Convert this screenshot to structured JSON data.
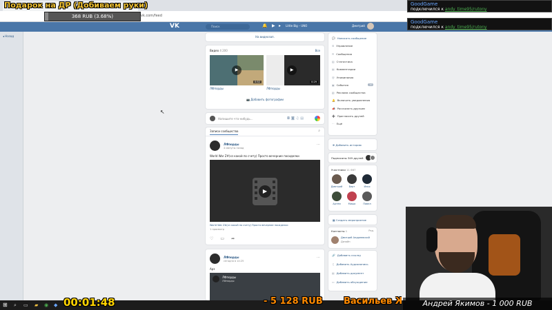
{
  "overlay": {
    "donation_goal_title": "Подарок на ДР (Добиваем руки)",
    "goal_progress_text": "368 RUB (3.68%)",
    "goal_progress_fraction": 0.0368,
    "big_donation": "- 5 128 RUB",
    "marquee_text": "Васильев Же",
    "last_donor": "Андрей Якимов - 1 000 RUB",
    "timer": "00:01:48",
    "chat_messages": [
      {
        "name": "GoodGame",
        "text": "подключился к ",
        "channel": "andy_time95/rutony"
      },
      {
        "name": "GoodGame",
        "text": "подключился к ",
        "channel": "andy_time95/rutony"
      }
    ]
  },
  "browser": {
    "url": "vk.com/feed"
  },
  "vk": {
    "search_placeholder": "Поиск",
    "player_label": "Little Big – UNO",
    "user_name": "Дмитрий",
    "left_item": "Назад",
    "to_top": "На видеозап.",
    "video_block": {
      "title": "Видео",
      "count": "4 200",
      "all_label": "Все",
      "videos": [
        {
          "caption": "ЛФпорды",
          "duration": "0:52"
        },
        {
          "caption": "ЛФпорды",
          "duration": "0:29"
        }
      ],
      "add_photo": "Добавить фотографии"
    },
    "compose_placeholder": "Напишите что-нибудь...",
    "wall_tab": "Записи сообщества",
    "post1": {
      "author": "ЛФпорды",
      "time": "4 минуты назад",
      "text": "World War Z#(хз какой по счету) Просто вечерние посиделки",
      "video_title": "World War Z#(хз какой по счету) Просто вечерние посиделки",
      "video_meta": "1 просмотр"
    },
    "post2": {
      "author": "ЛФпорды",
      "time": "сегодня в 14:25",
      "text": "Арз",
      "inner_author": "ЛФпорды",
      "inner_sub": "ЛФпорды"
    },
    "sidebar_menu": [
      "Написать сообщение",
      "Управление",
      "Сообщения",
      "Статистика",
      "Комментарии",
      "Упоминания",
      "События",
      "Реклама сообщества",
      "Включить уведомления",
      "Рассказать друзьям",
      "Пригласить друзей",
      "Ещё"
    ],
    "events_badge": "10",
    "add_story": "Добавить историю",
    "subscribers_label": "Подписаны 349 друзей",
    "members": {
      "title": "Участники",
      "count": "11 667",
      "people": [
        "Дмитрий",
        "Берт",
        "Илья",
        "Артём",
        "Миша",
        "Павел"
      ]
    },
    "create_event": "Создать мероприятие",
    "contacts": {
      "title": "Контакты",
      "count": "1",
      "all": "Ред.",
      "person": "Дмитрий Андреевский",
      "role": "Дизайн"
    },
    "actions": [
      "Добавить ссылку",
      "Добавить Аудиозапись",
      "Добавить документ",
      "Добавить обсуждение"
    ]
  },
  "colors": {
    "vk_blue": "#4a76a8",
    "link": "#2a5885",
    "timer_yellow": "#ffd400",
    "donate_orange": "#ff8a00"
  }
}
